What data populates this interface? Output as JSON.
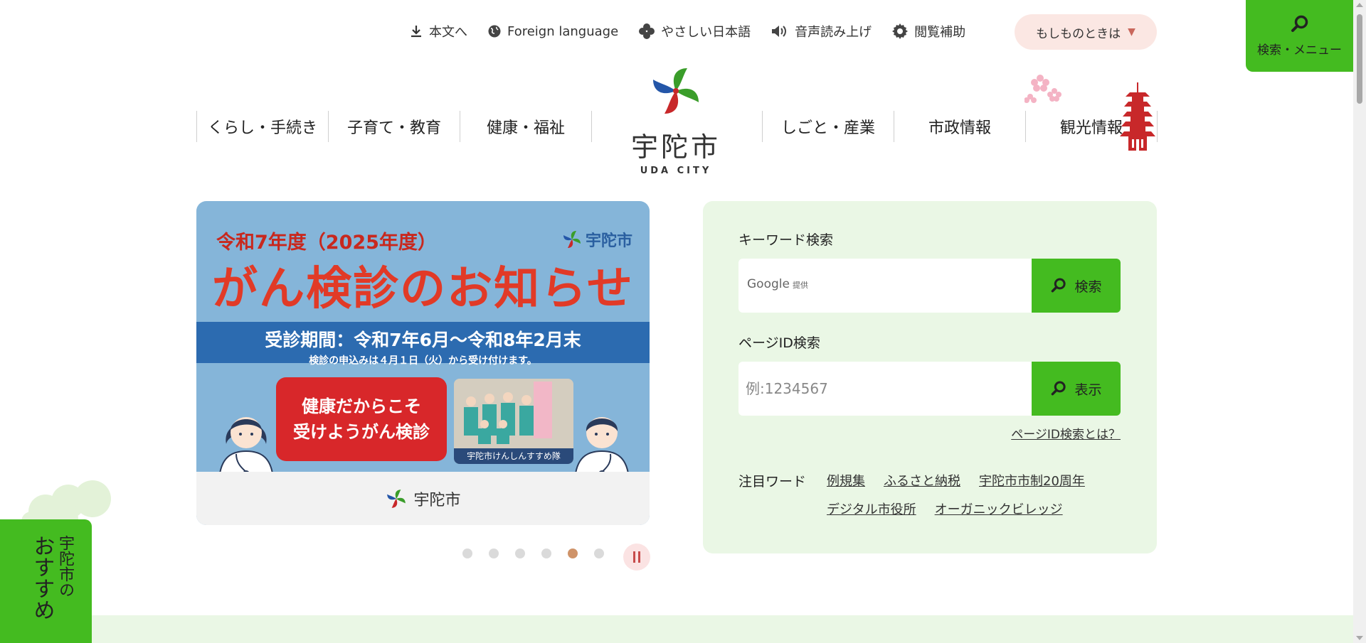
{
  "utility_nav": [
    {
      "label": "本文へ",
      "icon": "download-icon"
    },
    {
      "label": "Foreign language",
      "icon": "globe-icon"
    },
    {
      "label": "やさしい日本語",
      "icon": "clover-icon"
    },
    {
      "label": "音声読み上げ",
      "icon": "speaker-icon"
    },
    {
      "label": "閲覧補助",
      "icon": "gear-icon"
    }
  ],
  "emergency": {
    "label": "もしものときは",
    "icon": "chevron-down-icon"
  },
  "search_menu": {
    "label": "検索・メニュー",
    "icon": "search-icon"
  },
  "logo": {
    "name": "宇陀市",
    "sub": "UDA CITY"
  },
  "main_nav": {
    "left": [
      "くらし・手続き",
      "子育て・教育",
      "健康・福祉"
    ],
    "right": [
      "しごと・産業",
      "市政情報",
      "観光情報"
    ]
  },
  "banner": {
    "year": "令和7年度（2025年度）",
    "brand": "宇陀市",
    "title": "がん検診のお知らせ",
    "period": "受診期間：令和7年6月～令和8年2月末",
    "note": "検診の申込みは４月１日（火）から受け付けます。",
    "bubble": "健康だからこそ\n受けようがん検診",
    "photo_caption": "宇陀市けんしんすすめ隊",
    "footer": "宇陀市"
  },
  "carousel": {
    "count": 6,
    "active": 5
  },
  "search": {
    "keyword_label": "キーワード検索",
    "google_label": "Google",
    "google_sub": "提供",
    "search_button": "検索",
    "page_id_label": "ページID検索",
    "page_id_placeholder": "例:1234567",
    "page_id_button": "表示",
    "page_id_help": "ページID検索とは？",
    "featured_label": "注目ワード",
    "featured": [
      "例規集",
      "ふるさと納税",
      "宇陀市市制20周年",
      "デジタル市役所",
      "オーガニックビレッジ"
    ]
  },
  "recommend": {
    "line1": "宇陀市の",
    "line2": "おすすめ"
  },
  "colors": {
    "accent_green": "#44bb20",
    "panel_green": "#eaf7e5",
    "emergency_pink": "#fbe7e3",
    "active_dot": "#cf9369"
  }
}
